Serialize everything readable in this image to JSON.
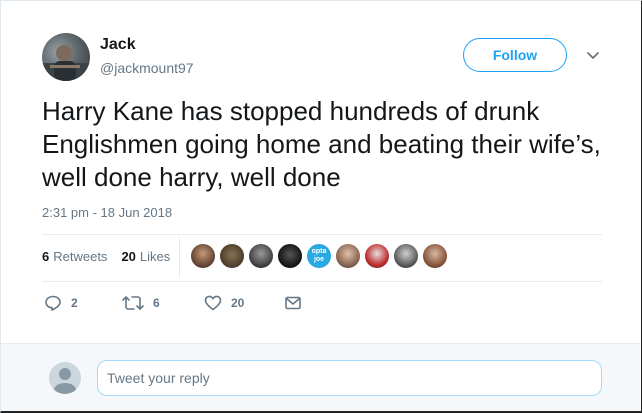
{
  "user": {
    "name": "Jack",
    "handle": "@jackmount97"
  },
  "follow_label": "Follow",
  "tweet": {
    "text": "Harry Kane has stopped hundreds of drunk Englishmen going home and beating their wife’s, well done harry, well done",
    "timestamp": "2:31 pm - 18 Jun 2018"
  },
  "stats": {
    "retweets_count": "6",
    "retweets_label": "Retweets",
    "likes_count": "20",
    "likes_label": "Likes"
  },
  "likers": {
    "opta_line1": "opta",
    "opta_line2": "joe"
  },
  "actions": {
    "reply_count": "2",
    "retweet_count": "6",
    "like_count": "20"
  },
  "reply": {
    "placeholder": "Tweet your reply"
  },
  "colors": {
    "accent": "#1da1f2",
    "muted": "#657786",
    "text": "#14171a"
  }
}
